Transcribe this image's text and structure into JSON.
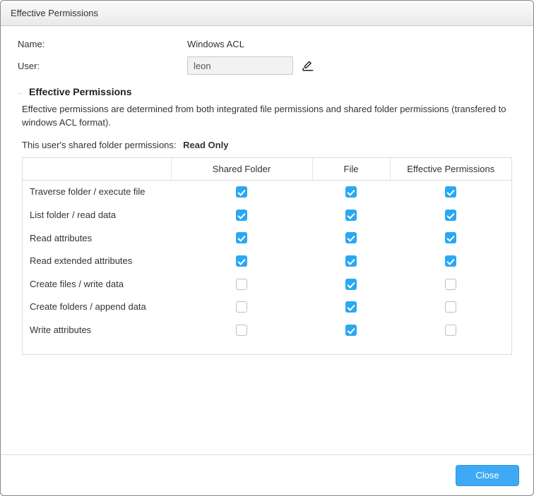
{
  "window": {
    "title": "Effective Permissions"
  },
  "form": {
    "name_label": "Name:",
    "name_value": "Windows ACL",
    "user_label": "User:",
    "user_value": "leon"
  },
  "fieldset": {
    "legend": "Effective Permissions",
    "description": "Effective permissions are determined from both integrated file permissions and shared folder permissions (transfered to windows ACL format).",
    "shared_label": "This user's shared folder permissions:",
    "shared_value": "Read Only"
  },
  "table": {
    "headers": {
      "name": "",
      "shared_folder": "Shared Folder",
      "file": "File",
      "effective": "Effective Permissions"
    },
    "rows": [
      {
        "label": "Traverse folder / execute file",
        "shared_folder": true,
        "file": true,
        "effective": true
      },
      {
        "label": "List folder / read data",
        "shared_folder": true,
        "file": true,
        "effective": true
      },
      {
        "label": "Read attributes",
        "shared_folder": true,
        "file": true,
        "effective": true
      },
      {
        "label": "Read extended attributes",
        "shared_folder": true,
        "file": true,
        "effective": true
      },
      {
        "label": "Create files / write data",
        "shared_folder": false,
        "file": true,
        "effective": false
      },
      {
        "label": "Create folders / append data",
        "shared_folder": false,
        "file": true,
        "effective": false
      },
      {
        "label": "Write attributes",
        "shared_folder": false,
        "file": true,
        "effective": false
      }
    ]
  },
  "footer": {
    "close": "Close"
  }
}
